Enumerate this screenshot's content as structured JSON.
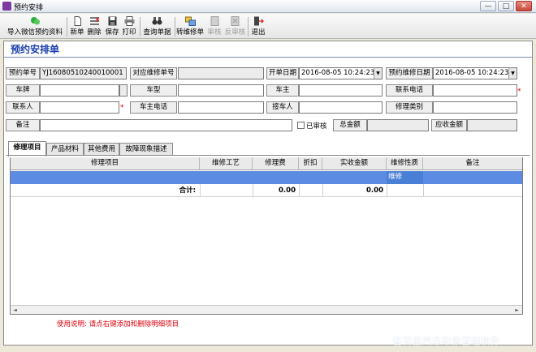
{
  "window": {
    "title": "预约安排",
    "minimize": "—",
    "maximize": "□",
    "close": "✕"
  },
  "toolbar": {
    "import_label": "导入微信预约资料",
    "new_label": "新单",
    "delete_label": "删除",
    "save_label": "保存",
    "print_label": "打印",
    "query_label": "查询单据",
    "convert_label": "转维修单",
    "approve_label": "审核",
    "unapprove_label": "反审核",
    "exit_label": "退出"
  },
  "form": {
    "title": "预约安排单",
    "booking_no_label": "预约单号",
    "booking_no_value": "YJ16080510240010001",
    "repair_no_label": "对应维修单号",
    "repair_no_value": "",
    "open_date_label": "开单日期",
    "open_date_value": "2016-08-05 10:24:23",
    "booking_repair_date_label": "预约维修日期",
    "booking_repair_date_value": "2016-08-05 10:24:23",
    "plate_label": "车牌",
    "plate_value": "",
    "model_label": "车型",
    "model_value": "",
    "owner_label": "车主",
    "owner_value": "",
    "contact_phone_label": "联系电话",
    "contact_phone_value": "",
    "contact_label": "联系人",
    "contact_value": "",
    "owner_phone_label": "车主电话",
    "owner_phone_value": "",
    "receiver_label": "接车人",
    "receiver_value": "",
    "repair_type_label": "修理类别",
    "repair_type_value": "",
    "remark_label": "备注",
    "remark_value": "",
    "approved_label": "已审核",
    "total_label": "总金额",
    "total_value": "",
    "receivable_label": "应收金额",
    "receivable_value": "",
    "required_mark": "*"
  },
  "tabs": [
    {
      "label": "修理项目"
    },
    {
      "label": "产品材料"
    },
    {
      "label": "其他费用"
    },
    {
      "label": "故障现象描述"
    }
  ],
  "grid": {
    "headers": [
      "修理项目",
      "维修工艺",
      "修理费",
      "折扣",
      "实收金额",
      "维修性质",
      "备注"
    ],
    "selected_row": {
      "nature": "维修"
    },
    "total_row": {
      "label": "合计:",
      "repair_fee": "0.00",
      "actual": "0.00"
    },
    "scroll_left": "◄",
    "scroll_right": "►"
  },
  "hint": "使用说明: 请点右键添加和删除明细项目",
  "watermark": "智百盛汽车维修管理软件",
  "colors": {
    "accent": "#1a3fb0",
    "selected_row": "#5b8be2",
    "required": "#e0000b"
  }
}
